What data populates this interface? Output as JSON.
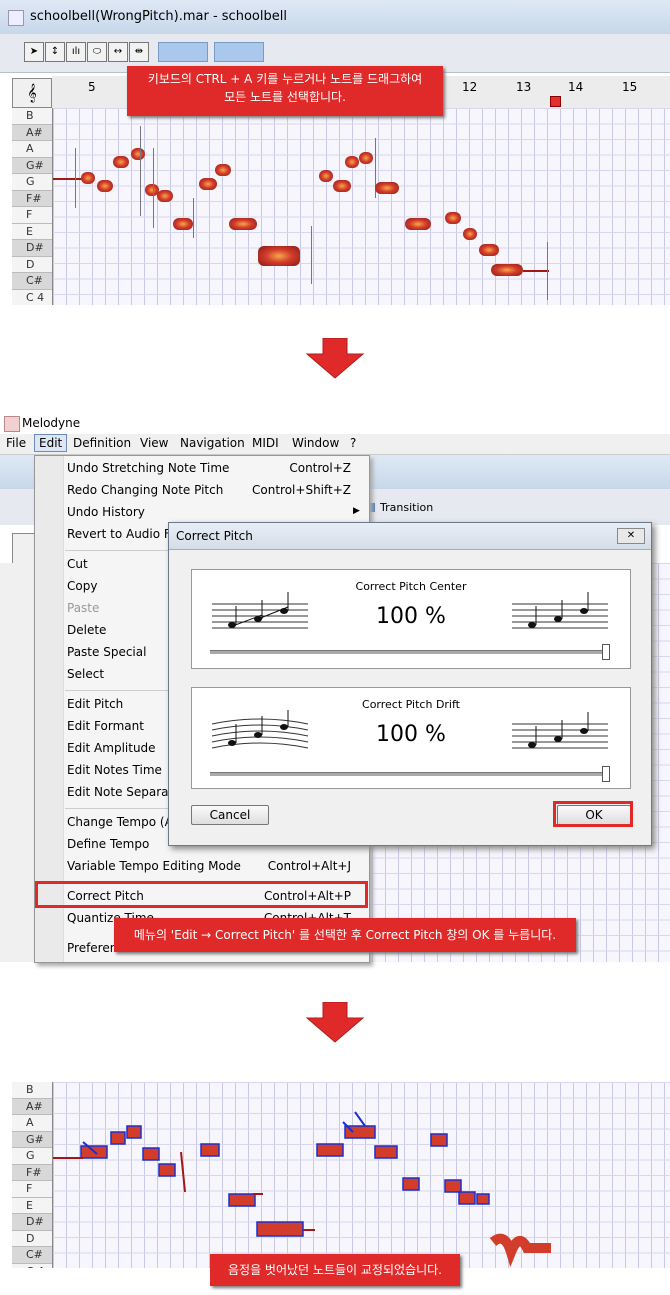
{
  "top_window": {
    "title": "schoolbell(WrongPitch).mar - schoolbell",
    "ruler_numbers": [
      "5",
      "12",
      "13",
      "14",
      "15"
    ]
  },
  "callout1": {
    "line1": "키보드의 CTRL + A 키를 누르거나 노트를 드래그하여",
    "line2": "모든 노트를 선택합니다."
  },
  "pitch_keys": [
    "B",
    "A#",
    "A",
    "G#",
    "G",
    "F#",
    "F",
    "E",
    "D#",
    "D",
    "C#",
    "C 4"
  ],
  "app_title": "Melodyne",
  "menubar": [
    "File",
    "Edit",
    "Definition",
    "View",
    "Navigation",
    "MIDI",
    "Window",
    "?"
  ],
  "second_window": {
    "transition_label": "Transition"
  },
  "edit_menu": {
    "items": [
      {
        "label": "Undo Stretching Note Time",
        "shortcut": "Control+Z"
      },
      {
        "label": "Redo Changing Note Pitch",
        "shortcut": "Control+Shift+Z"
      },
      {
        "label": "Undo History",
        "shortcut": ""
      },
      {
        "label": "Revert to Audio Fil",
        "shortcut": ""
      },
      {
        "label": "Cut",
        "shortcut": ""
      },
      {
        "label": "Copy",
        "shortcut": ""
      },
      {
        "label": "Paste",
        "shortcut": ""
      },
      {
        "label": "Delete",
        "shortcut": ""
      },
      {
        "label": "Paste Special",
        "shortcut": ""
      },
      {
        "label": "Select",
        "shortcut": ""
      },
      {
        "label": "Edit Pitch",
        "shortcut": ""
      },
      {
        "label": "Edit Formant",
        "shortcut": ""
      },
      {
        "label": "Edit Amplitude",
        "shortcut": ""
      },
      {
        "label": "Edit Notes Time",
        "shortcut": ""
      },
      {
        "label": "Edit Note Separatio",
        "shortcut": ""
      },
      {
        "label": "Change Tempo (Au",
        "shortcut": ""
      },
      {
        "label": "Define Tempo",
        "shortcut": ""
      },
      {
        "label": "Variable Tempo Editing Mode",
        "shortcut": "Control+Alt+J"
      },
      {
        "label": "Correct Pitch",
        "shortcut": "Control+Alt+P"
      },
      {
        "label": "Quantize Time",
        "shortcut": "Control+Alt+T"
      },
      {
        "label": "Preferen",
        "shortcut": ""
      }
    ]
  },
  "dialog": {
    "title": "Correct Pitch",
    "center_label": "Correct Pitch Center",
    "center_value": "100 %",
    "center_level": 1.0,
    "drift_label": "Correct Pitch Drift",
    "drift_value": "100 %",
    "drift_level": 1.0,
    "cancel_label": "Cancel",
    "ok_label": "OK"
  },
  "callout2": "메뉴의 'Edit → Correct Pitch' 를 선택한 후 Correct Pitch 창의 OK 를 누릅니다.",
  "callout3": "음정을 벗어났던 노트들이 교정되었습니다.",
  "colors": {
    "callout": "#e02a2a",
    "note": "#d23c2a",
    "highlight": "#e02a2a"
  }
}
